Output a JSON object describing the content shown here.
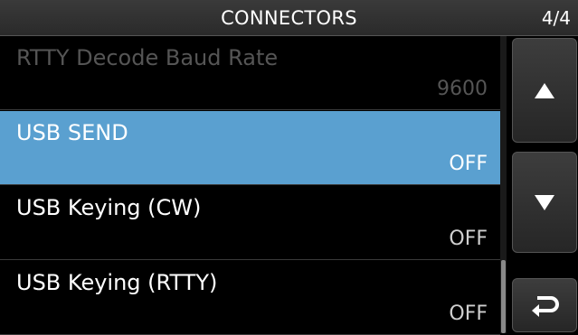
{
  "header": {
    "title": "CONNECTORS",
    "page_indicator": "4/4"
  },
  "menu": {
    "items": [
      {
        "label": "RTTY Decode Baud Rate",
        "value": "9600",
        "state": "disabled"
      },
      {
        "label": "USB SEND",
        "value": "OFF",
        "state": "selected"
      },
      {
        "label": "USB Keying (CW)",
        "value": "OFF",
        "state": "normal"
      },
      {
        "label": "USB Keying (RTTY)",
        "value": "OFF",
        "state": "normal"
      }
    ]
  },
  "controls": {
    "up_icon": "triangle-up-icon",
    "down_icon": "triangle-down-icon",
    "back_icon": "return-arrow-icon"
  },
  "colors": {
    "selection": "#5aa0d0",
    "background": "#000000",
    "disabled_text": "#555555"
  }
}
